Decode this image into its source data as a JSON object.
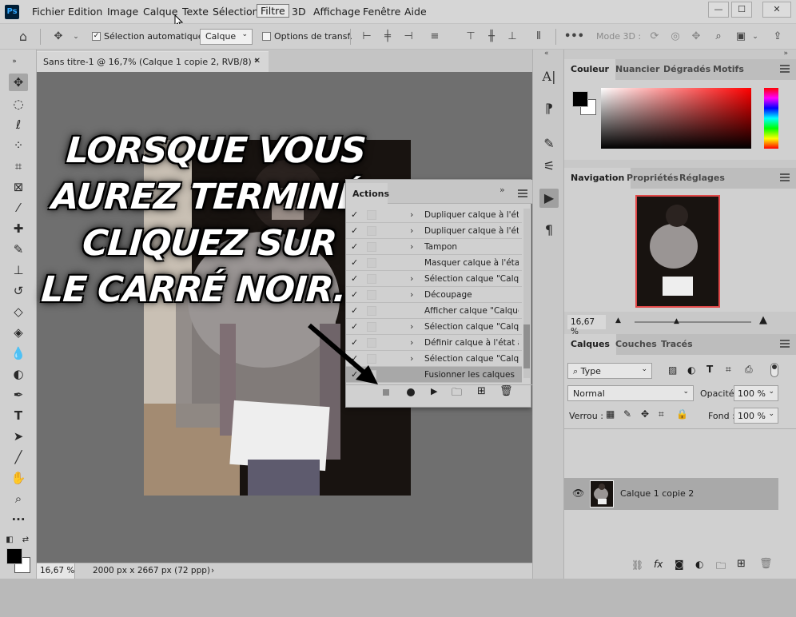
{
  "menubar": {
    "logo": "Ps",
    "items": [
      "Fichier",
      "Edition",
      "Image",
      "Calque",
      "Texte",
      "Sélection",
      "Filtre",
      "3D",
      "Affichage",
      "Fenêtre",
      "Aide"
    ]
  },
  "options": {
    "auto_select_label": "Sélection automatique :",
    "layer_select": "Calque",
    "transform_label": "Options de transf.",
    "mode3d_label": "Mode 3D :",
    "more": "•••"
  },
  "document": {
    "tab_title": "Sans titre-1 @ 16,7% (Calque 1 copie 2, RVB/8) *",
    "zoom": "16,67 %",
    "size_info": "2000 px x 2667 px (72 ppp)"
  },
  "caption": {
    "lines": [
      "LORSQUE VOUS",
      "AUREZ TERMINÉ,",
      "CLIQUEZ SUR",
      "LE CARRÉ NOIR..."
    ]
  },
  "actions_panel": {
    "title": "Actions",
    "rows": [
      {
        "label": "Dupliquer calque à l'ét...",
        "expandable": true
      },
      {
        "label": "Dupliquer calque à l'ét...",
        "expandable": true
      },
      {
        "label": "Tampon",
        "expandable": true
      },
      {
        "label": "Masquer calque à l'état...",
        "expandable": false
      },
      {
        "label": "Sélection calque \"Calqu...",
        "expandable": true
      },
      {
        "label": "Découpage",
        "expandable": true
      },
      {
        "label": "Afficher calque \"Calque...",
        "expandable": false
      },
      {
        "label": "Sélection calque \"Calqu...",
        "expandable": true
      },
      {
        "label": "Définir calque à l'état a...",
        "expandable": true
      },
      {
        "label": "Sélection calque \"Calqu...",
        "expandable": true
      },
      {
        "label": "Fusionner les calques",
        "expandable": false,
        "selected": true
      }
    ]
  },
  "color_panel": {
    "tabs": [
      "Couleur",
      "Nuancier",
      "Dégradés",
      "Motifs"
    ],
    "accent_hue": "#ff0000"
  },
  "navigation_panel": {
    "tabs": [
      "Navigation",
      "Propriétés",
      "Réglages"
    ],
    "zoom": "16,67 %"
  },
  "layers_panel": {
    "tabs": [
      "Calques",
      "Couches",
      "Tracés"
    ],
    "filter_type": "Type",
    "blend_mode": "Normal",
    "opacity_label": "Opacité :",
    "opacity_value": "100 %",
    "lock_label": "Verrou :",
    "fill_label": "Fond :",
    "fill_value": "100 %",
    "layer_name": "Calque 1 copie 2"
  },
  "colors": {
    "foreground": "#000000",
    "background": "#ffffff"
  }
}
